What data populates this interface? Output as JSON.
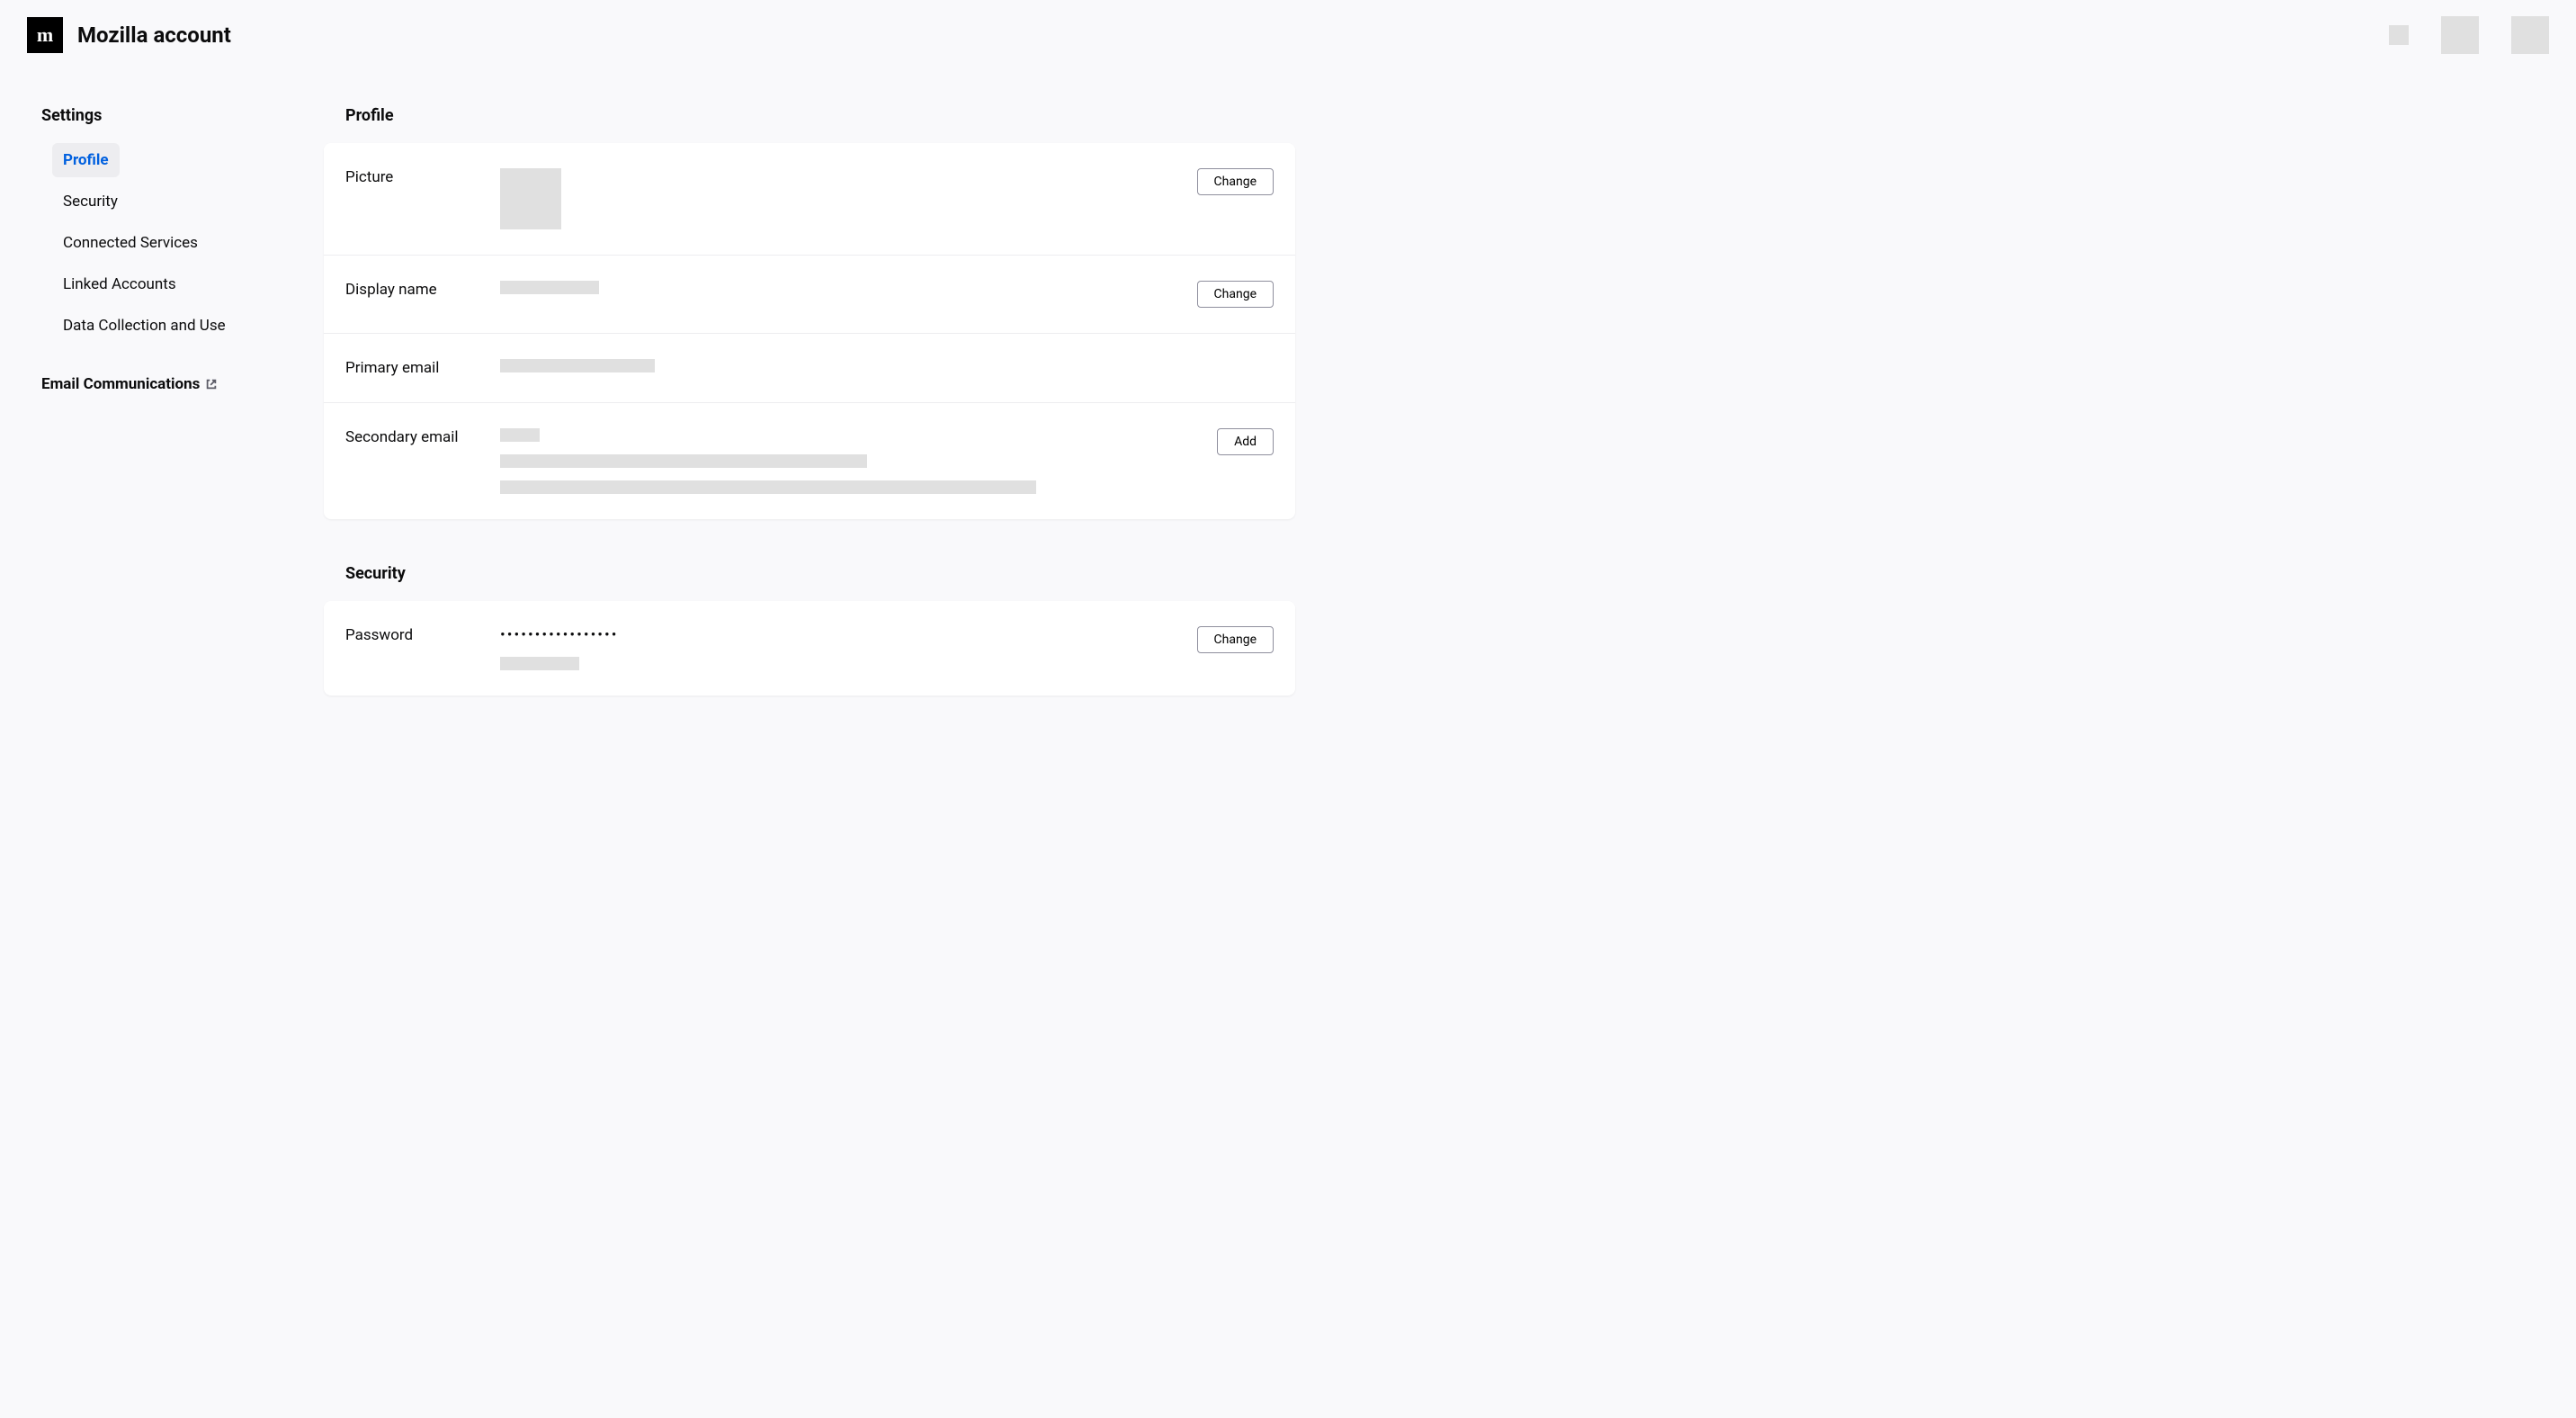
{
  "header": {
    "title": "Mozilla account"
  },
  "sidebar": {
    "heading": "Settings",
    "items": [
      {
        "label": "Profile",
        "active": true
      },
      {
        "label": "Security",
        "active": false
      },
      {
        "label": "Connected Services",
        "active": false
      },
      {
        "label": "Linked Accounts",
        "active": false
      },
      {
        "label": "Data Collection and Use",
        "active": false
      }
    ],
    "bottom_link": "Email Communications"
  },
  "sections": {
    "profile": {
      "heading": "Profile",
      "rows": {
        "picture": {
          "label": "Picture",
          "button": "Change"
        },
        "display_name": {
          "label": "Display name",
          "button": "Change"
        },
        "primary_email": {
          "label": "Primary email"
        },
        "secondary_email": {
          "label": "Secondary email",
          "button": "Add"
        }
      }
    },
    "security": {
      "heading": "Security",
      "rows": {
        "password": {
          "label": "Password",
          "value": "•••••••••••••••••",
          "button": "Change"
        }
      }
    }
  }
}
